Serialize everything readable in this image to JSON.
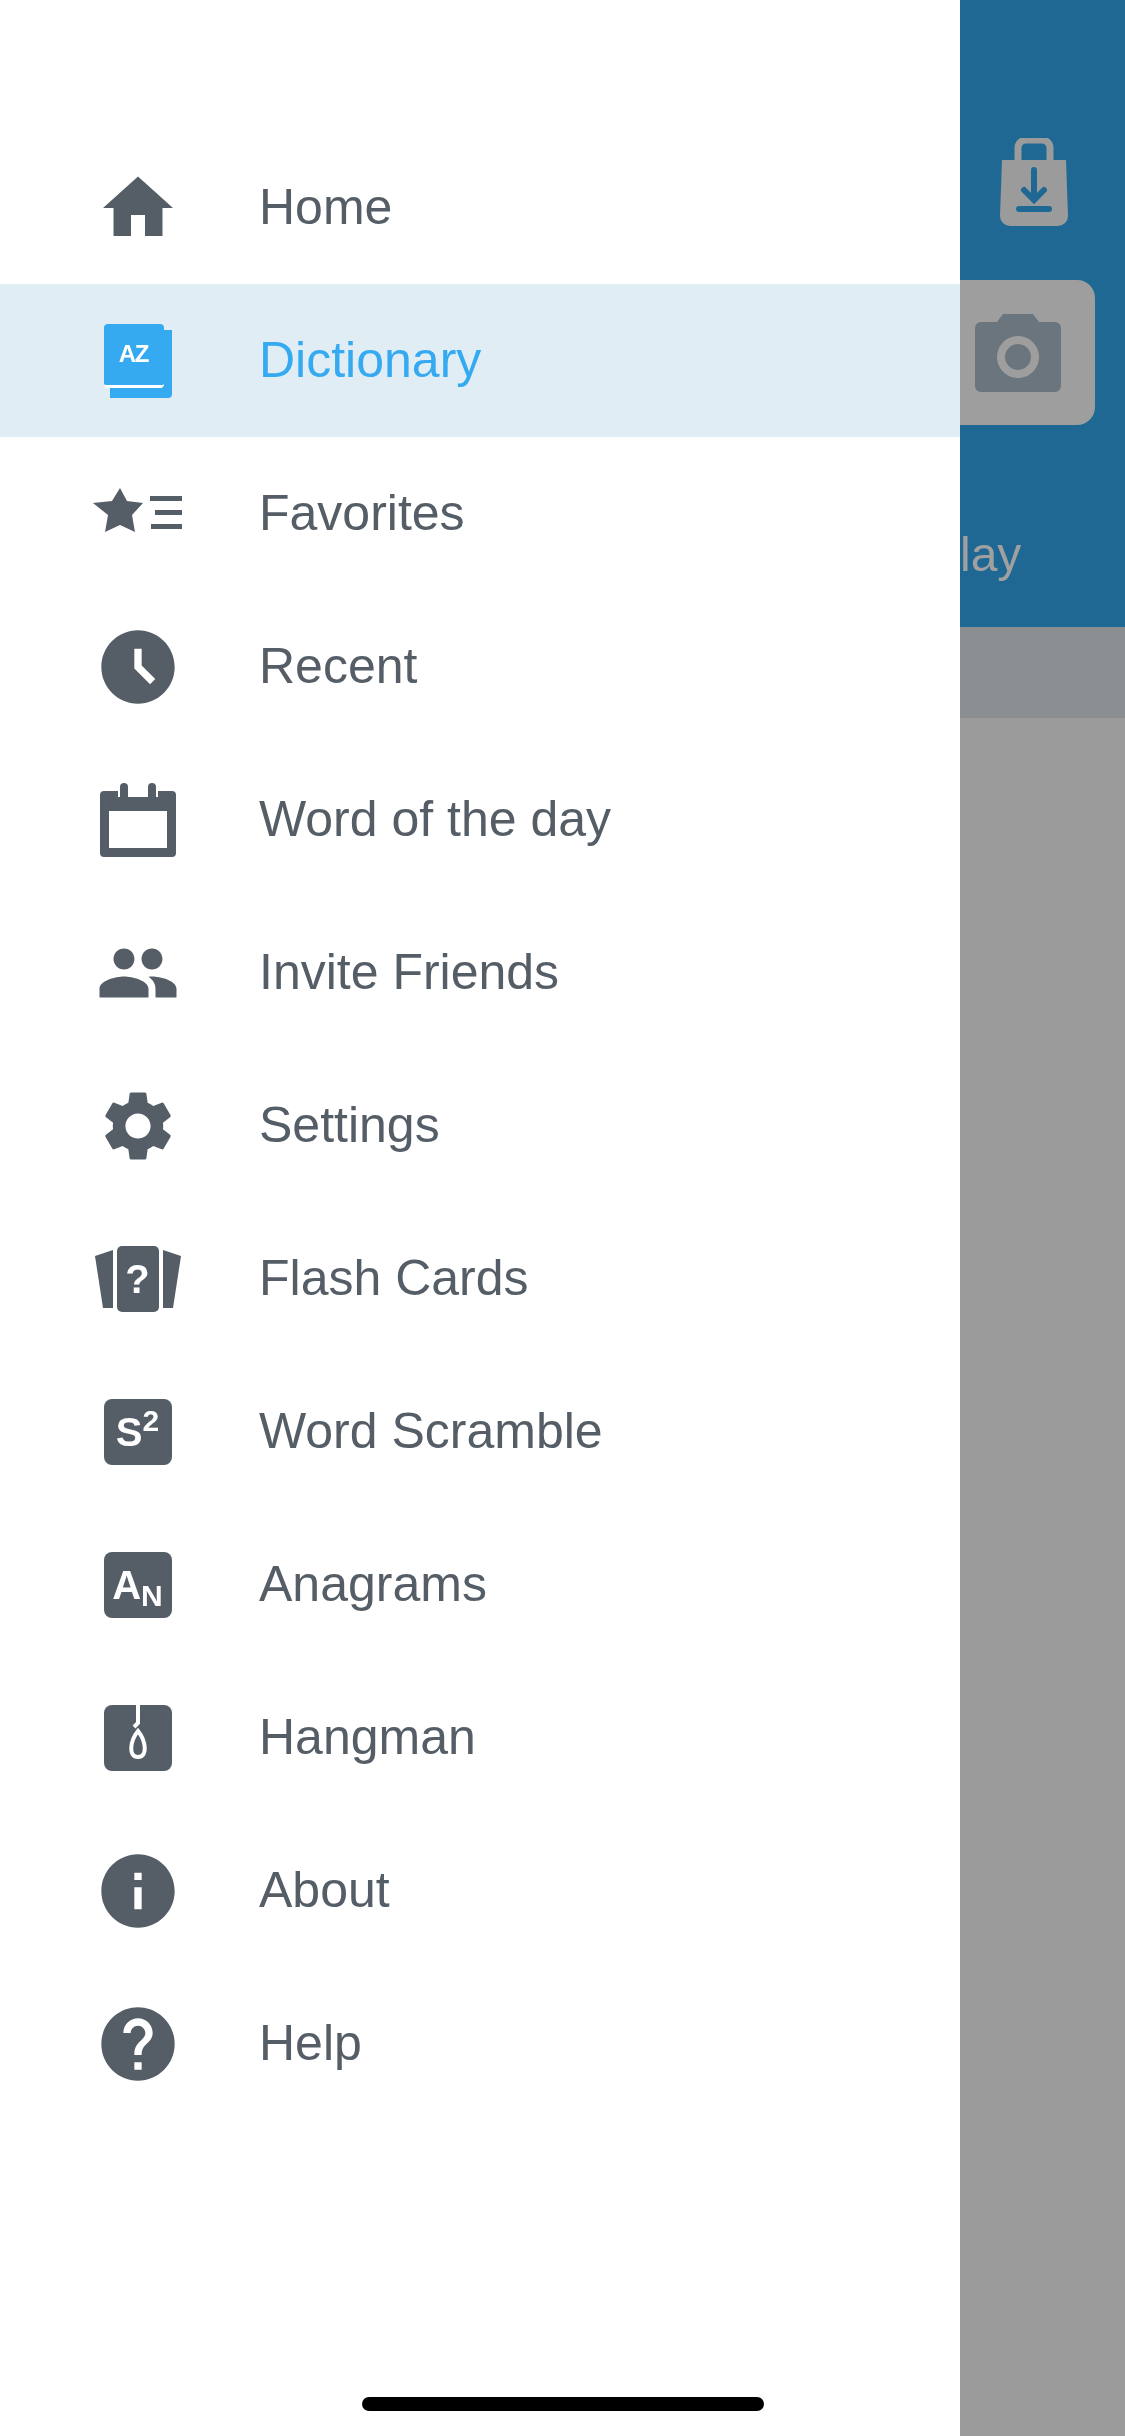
{
  "menu": {
    "items": [
      {
        "kind": "home",
        "label": "Home",
        "selected": false
      },
      {
        "kind": "dictionary",
        "icon_text": "AZ",
        "label": "Dictionary",
        "selected": true
      },
      {
        "kind": "favorites",
        "label": "Favorites",
        "selected": false
      },
      {
        "kind": "recent",
        "label": "Recent",
        "selected": false
      },
      {
        "kind": "calendar",
        "label": "Word of the day",
        "selected": false
      },
      {
        "kind": "friends",
        "label": "Invite Friends",
        "selected": false
      },
      {
        "kind": "settings",
        "label": "Settings",
        "selected": false
      },
      {
        "kind": "cards",
        "icon_text": "?",
        "label": "Flash Cards",
        "selected": false
      },
      {
        "kind": "tile",
        "icon_text": "S$^{2}$",
        "label": "Word Scramble",
        "selected": false
      },
      {
        "kind": "tile",
        "icon_text": "A$_{N}$",
        "label": "Anagrams",
        "selected": false
      },
      {
        "kind": "noose",
        "label": "Hangman",
        "selected": false
      },
      {
        "kind": "info",
        "label": "About",
        "selected": false
      },
      {
        "kind": "help",
        "label": "Help",
        "selected": false
      }
    ]
  },
  "background": {
    "header_text": "lay"
  }
}
